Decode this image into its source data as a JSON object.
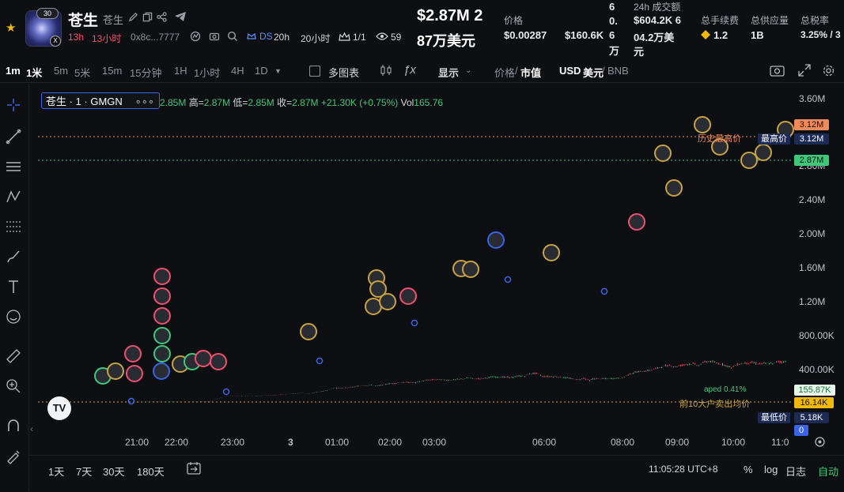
{
  "header": {
    "token_name": "苍生",
    "token_sub": "苍生",
    "age_badge": "30",
    "age_a": "13h",
    "age_b": "13小时",
    "address": "0x8c...7777",
    "ds_label": "DS",
    "ds_time": "20h",
    "ds_time2": "20小时",
    "holders": "1/1",
    "views": "59",
    "mcap_line1": "$2.87M 2",
    "mcap_line2": "87万美元",
    "price_label": "价格",
    "price_value": "$0.00287",
    "liquidity_value": "$160.6K",
    "liq_suffix": [
      "6",
      "0.",
      "6",
      "万"
    ],
    "volume_label": "24h 成交额",
    "volume_value1": "$604.2K 6",
    "volume_value2": "04.2万美",
    "volume_value3": "元",
    "fee_label": "总手续费",
    "fee_value": "1.2",
    "supply_label": "总供应量",
    "supply_value": "1B",
    "tax_label": "总税率",
    "tax_value": "3.25% / 3"
  },
  "toolbar": {
    "intervals": [
      "1m",
      "1米",
      "5m",
      "5米",
      "15m",
      "15分钟",
      "1H",
      "1小时",
      "4H",
      "1D"
    ],
    "active_interval": "1m",
    "multi_chart": "多图表",
    "display": "显示",
    "price_label": "价格",
    "mcap_label": "市值",
    "currency_usd": "USD",
    "currency_cny": "美元",
    "currency_bnb": "BNB"
  },
  "chart": {
    "legend": "苍生 · 1 · GMGN",
    "ohlc": {
      "open_value": "2.85M",
      "high_label": "高=",
      "high_value": "2.87M",
      "low_label": "低=",
      "low_value": "2.85M",
      "close_label": "收=",
      "close_value": "2.87M",
      "change": "+21.30K (+0.75%)",
      "vol_label": "Vol",
      "vol_value": "165.76"
    },
    "y_ticks": [
      "3.60M",
      "2.80M",
      "2.40M",
      "2.00M",
      "1.60M",
      "1.20M",
      "800.00K",
      "400.00K"
    ],
    "x_ticks": [
      "21:00",
      "22:00",
      "23:00",
      "3",
      "01:00",
      "02:00",
      "03:00",
      "06:00",
      "08:00",
      "09:00",
      "10:00",
      "11:0"
    ],
    "labels": {
      "ath_top": "3.12M",
      "ath_text": "最高价",
      "ath_value": "3.12M",
      "ath_line_text": "历史最高价",
      "current": "2.87M",
      "aped_text": "aped 0.41%",
      "aped_value": "155.87K",
      "top10_text": "前10大户卖出均价",
      "top10_value": "16.14K",
      "low_text": "最低价",
      "low_value": "5.18K",
      "zero": "0"
    },
    "colors": {
      "up": "#3fc87a",
      "down": "#f0506e",
      "ath": "#f08a5d",
      "current": "#3fc87a"
    },
    "series": [
      [
        0,
        0.45
      ],
      [
        0.2,
        0.45
      ],
      [
        0.4,
        0.6
      ],
      [
        0.5,
        0.75
      ],
      [
        0.7,
        2.3
      ],
      [
        1.0,
        1.0
      ],
      [
        1.3,
        1.6
      ],
      [
        1.7,
        2.3
      ],
      [
        2.4,
        3.5
      ],
      [
        2.8,
        5.2
      ],
      [
        2.9,
        15
      ],
      [
        3.2,
        48
      ],
      [
        3.4,
        74
      ],
      [
        3.9,
        68
      ],
      [
        4.4,
        68
      ],
      [
        4.7,
        80
      ],
      [
        5.1,
        82
      ],
      [
        5.5,
        94
      ],
      [
        5.9,
        104
      ],
      [
        6.2,
        100
      ],
      [
        6.5,
        116
      ],
      [
        6.8,
        137
      ],
      [
        7.0,
        162
      ],
      [
        7.3,
        163
      ],
      [
        7.6,
        171
      ],
      [
        7.9,
        188
      ],
      [
        8.3,
        200
      ],
      [
        8.5,
        188
      ],
      [
        8.9,
        214
      ],
      [
        9.2,
        223
      ],
      [
        9.5,
        230
      ],
      [
        9.8,
        226
      ],
      [
        10.0,
        246
      ],
      [
        10.3,
        259
      ],
      [
        10.6,
        264
      ],
      [
        10.9,
        255
      ],
      [
        11.4,
        270
      ],
      [
        11.6,
        282
      ],
      [
        11.8,
        270
      ],
      [
        12.1,
        277
      ],
      [
        12.4,
        293
      ],
      [
        12.8,
        291
      ],
      [
        13.1,
        288
      ],
      [
        13.3,
        305
      ],
      [
        13.5,
        301
      ],
      [
        13.6,
        325
      ],
      [
        13.9,
        338
      ],
      [
        14.1,
        300
      ],
      [
        14.4,
        298
      ],
      [
        14.7,
        292
      ],
      [
        15.0,
        278
      ],
      [
        15.3,
        260
      ],
      [
        15.5,
        279
      ],
      [
        15.7,
        250
      ],
      [
        15.8,
        270
      ],
      [
        16.0,
        272
      ],
      [
        16.3,
        274
      ],
      [
        16.8,
        280
      ],
      [
        17.0,
        320
      ],
      [
        17.3,
        352
      ],
      [
        17.6,
        362
      ],
      [
        17.8,
        378
      ],
      [
        18.0,
        398
      ],
      [
        18.2,
        420
      ],
      [
        18.4,
        428
      ],
      [
        18.6,
        412
      ],
      [
        18.9,
        440
      ],
      [
        19.2,
        447
      ],
      [
        19.4,
        428
      ],
      [
        19.6,
        472
      ],
      [
        19.8,
        475
      ],
      [
        20.0,
        455
      ],
      [
        20.2,
        442
      ],
      [
        20.5,
        405
      ],
      [
        20.7,
        440
      ],
      [
        20.9,
        453
      ],
      [
        21.2,
        462
      ],
      [
        21.4,
        448
      ],
      [
        21.6,
        452
      ],
      [
        21.9,
        450
      ],
      [
        22.1,
        478
      ],
      [
        22.2,
        468
      ],
      [
        22.4,
        478
      ]
    ]
  },
  "bottom": {
    "ranges": [
      "1天",
      "7天",
      "30天",
      "180天"
    ],
    "clock": "11:05:28 UTC+8",
    "percent": "%",
    "log": "log",
    "journal": "日志",
    "auto": "自动"
  }
}
